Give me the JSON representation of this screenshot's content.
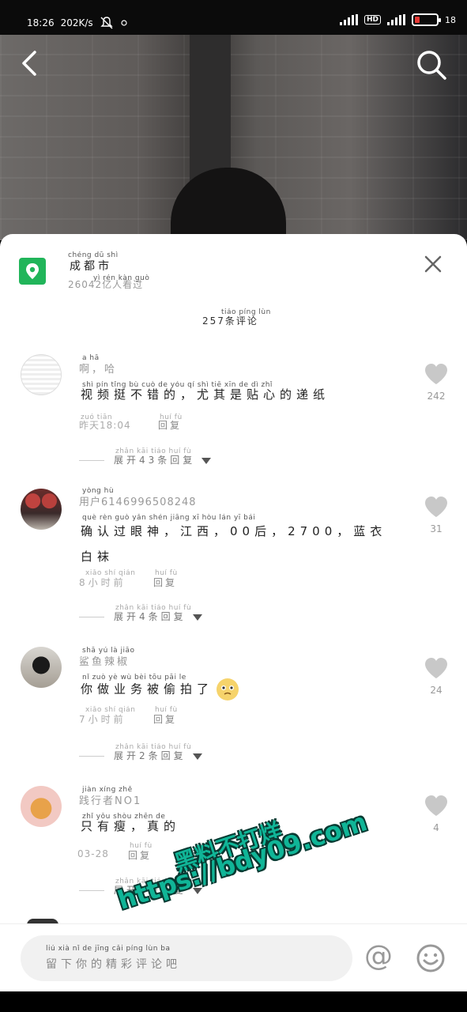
{
  "status_bar": {
    "time": "18:26",
    "speed": "202K/s",
    "hd": "HD",
    "battery": "18"
  },
  "location": {
    "name_pinyin": "chéng dū shì",
    "name": "成都市",
    "views_pinyin": "yì rén kàn guò",
    "views": "26042亿人看过"
  },
  "comments_header": {
    "pinyin": "tiáo píng lùn",
    "text": "257条评论"
  },
  "comments": [
    {
      "user_pinyin": "a   hā",
      "user": "啊，哈",
      "text_pinyin": "shì  pín  tǐng  bù  cuò  de      yóu  qí  shì  tiē  xīn  de  dì  zhǐ",
      "text": "视频挺不错的，尤其是贴心的递纸",
      "time_pinyin": "zuó tiān",
      "time": "昨天18:04",
      "reply_pinyin": "huí fù",
      "reply": "回复",
      "expand_pinyin": "zhǎn kāi      tiáo huí fù",
      "expand": "展开43条回复",
      "likes": "242"
    },
    {
      "user_pinyin": "yòng hù",
      "user": "用户6146996508248",
      "text_pinyin": "què rèn guò yǎn shén     jiāng xī       hòu               lán  yī  bái",
      "text": "确认过眼神，江西，00后，2700，蓝衣白袜",
      "time_pinyin": "xiǎo shí qián",
      "time": "8小时前",
      "reply_pinyin": "huí fù",
      "reply": "回复",
      "expand_pinyin": "zhǎn kāi    tiáo huí fù",
      "expand": "展开4条回复",
      "likes": "31"
    },
    {
      "user_pinyin": "shā  yú  là  jiāo",
      "user": "鲨鱼辣椒",
      "text_pinyin": "nǐ  zuò  yè  wù  bèi  tōu  pāi  le",
      "text": "你做业务被偷拍了",
      "time_pinyin": "xiǎo shí qián",
      "time": "7小时前",
      "reply_pinyin": "huí fù",
      "reply": "回复",
      "expand_pinyin": "zhǎn kāi    tiáo huí fù",
      "expand": "展开2条回复",
      "likes": "24"
    },
    {
      "user_pinyin": "jiàn xíng zhě",
      "user": "践行者NO1",
      "text_pinyin": "zhǐ  yǒu  shòu     zhēn  de",
      "text": "只有瘦，真的",
      "time_pinyin": "",
      "time": "03-28",
      "reply_pinyin": "huí fù",
      "reply": "回复",
      "expand_pinyin": "zhǎn kāi    tiáo huí fù",
      "expand": "展开1条回复",
      "likes": "4"
    }
  ],
  "input": {
    "pinyin": "liú  xià  nǐ  de  jīng  cǎi  píng  lùn  ba",
    "placeholder": "留下你的精彩评论吧"
  },
  "at_symbol": "@",
  "watermark": {
    "line1": "黑料不打烊",
    "line2": "https://bdy09.com"
  },
  "colors": {
    "location_icon": "#21b55a",
    "watermark": "#10b597"
  }
}
